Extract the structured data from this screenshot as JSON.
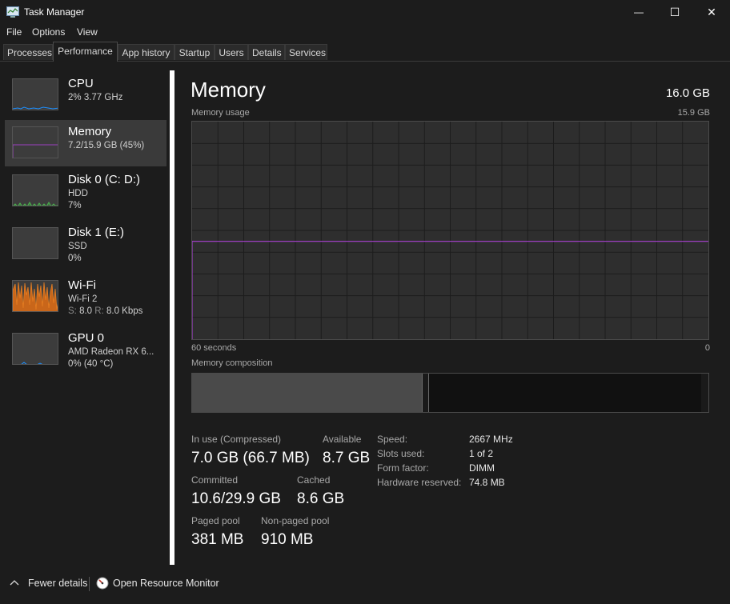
{
  "window": {
    "title": "Task Manager",
    "buttons": {
      "minimize": "—",
      "maximize": "☐",
      "close": "✕"
    }
  },
  "menu": [
    "File",
    "Options",
    "View"
  ],
  "tabs": [
    "Processes",
    "Performance",
    "App history",
    "Startup",
    "Users",
    "Details",
    "Services"
  ],
  "active_tab": "Performance",
  "sidebar": {
    "items": [
      {
        "name": "CPU",
        "lines": [
          "2% 3.77 GHz"
        ]
      },
      {
        "name": "Memory",
        "lines": [
          "7.2/15.9 GB (45%)"
        ],
        "selected": true
      },
      {
        "name": "Disk 0 (C: D:)",
        "lines": [
          "HDD",
          "7%"
        ]
      },
      {
        "name": "Disk 1 (E:)",
        "lines": [
          "SSD",
          "0%"
        ]
      },
      {
        "name": "Wi-Fi",
        "lines": [
          "Wi-Fi 2"
        ],
        "wifi_rate": {
          "s_label": "S:",
          "s_value": "8.0",
          "r_label": "R:",
          "r_value": "8.0 Kbps"
        }
      },
      {
        "name": "GPU 0",
        "lines": [
          "AMD Radeon RX 6...",
          "0% (40 °C)"
        ]
      }
    ]
  },
  "main": {
    "title": "Memory",
    "total": "16.0 GB",
    "usage_label": "Memory usage",
    "usage_max": "15.9 GB",
    "time_left": "60 seconds",
    "time_right": "0",
    "composition_label": "Memory composition",
    "usage_fraction": 0.45,
    "stats": {
      "in_use": {
        "label": "In use (Compressed)",
        "value": "7.0 GB (66.7 MB)"
      },
      "available": {
        "label": "Available",
        "value": "8.7 GB"
      },
      "committed": {
        "label": "Committed",
        "value": "10.6/29.9 GB"
      },
      "cached": {
        "label": "Cached",
        "value": "8.6 GB"
      },
      "paged_pool": {
        "label": "Paged pool",
        "value": "381 MB"
      },
      "nonpaged_pool": {
        "label": "Non-paged pool",
        "value": "910 MB"
      }
    },
    "specs": [
      {
        "label": "Speed:",
        "value": "2667 MHz"
      },
      {
        "label": "Slots used:",
        "value": "1 of 2"
      },
      {
        "label": "Form factor:",
        "value": "DIMM"
      },
      {
        "label": "Hardware reserved:",
        "value": "74.8 MB"
      }
    ]
  },
  "footer": {
    "fewer_details": "Fewer details",
    "resource_monitor": "Open Resource Monitor"
  },
  "colors": {
    "memory_line": "#9b3fc0",
    "cpu_line": "#1e90ff",
    "disk_line": "#4caf50",
    "wifi_fill": "#e67e22"
  }
}
